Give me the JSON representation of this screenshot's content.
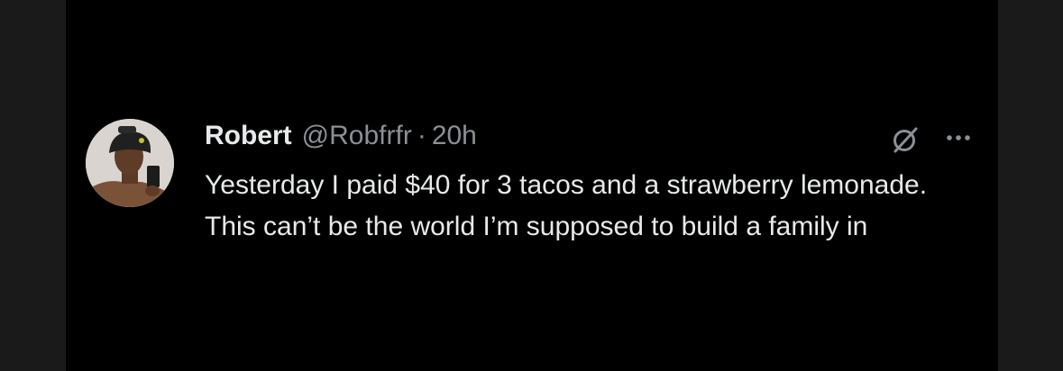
{
  "tweet": {
    "display_name": "Robert",
    "handle": "@Robfrfr",
    "separator": "·",
    "timestamp": "20h",
    "text": "Yesterday I paid $40 for 3 tacos and a strawberry lemonade. This can’t be the world I’m supposed to build a family in",
    "avatar_icon": "profile-photo",
    "action_icons": [
      "grok-icon",
      "more-options-icon"
    ]
  },
  "colors": {
    "background": "#000000",
    "outer_background": "#1a1a1a",
    "primary_text": "#e7e9ea",
    "secondary_text": "#8b9096"
  }
}
